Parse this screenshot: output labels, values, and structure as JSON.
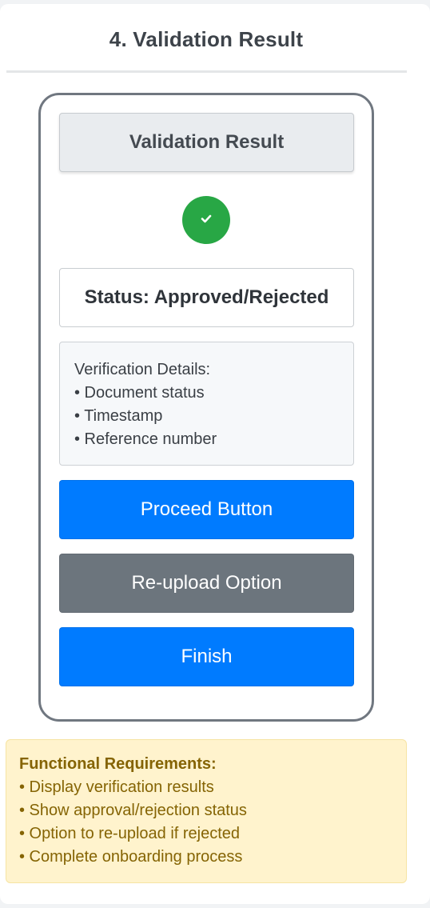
{
  "section": {
    "title": "4. Validation Result"
  },
  "screen": {
    "header": "Validation Result",
    "status_icon": "check-icon",
    "status": "Status: Approved/Rejected",
    "details": {
      "heading": "Verification Details:",
      "items": [
        "• Document status",
        "• Timestamp",
        "• Reference number"
      ]
    },
    "buttons": {
      "proceed": "Proceed Button",
      "reupload": "Re-upload Option",
      "finish": "Finish"
    }
  },
  "requirements": {
    "title": "Functional Requirements:",
    "items": [
      "• Display verification results",
      "• Show approval/rejection status",
      "• Option to re-upload if rejected",
      "• Complete onboarding process"
    ]
  },
  "colors": {
    "primary": "#007bff",
    "secondary": "#6c757d",
    "success": "#28a745",
    "warning_bg": "#fff3cd",
    "warning_text": "#856404"
  }
}
